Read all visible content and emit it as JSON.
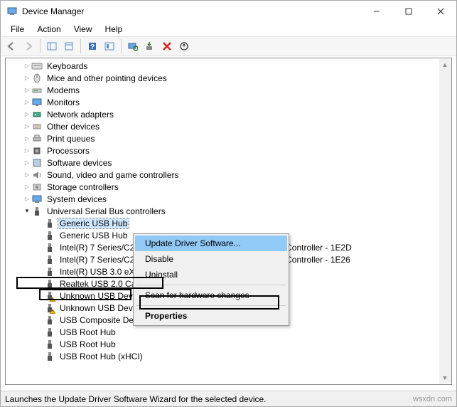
{
  "window": {
    "title": "Device Manager"
  },
  "menu": {
    "file": "File",
    "action": "Action",
    "view": "View",
    "help": "Help"
  },
  "tree": {
    "items": [
      {
        "label": "Keyboards",
        "icon": "keyboard"
      },
      {
        "label": "Mice and other pointing devices",
        "icon": "mouse"
      },
      {
        "label": "Modems",
        "icon": "modem"
      },
      {
        "label": "Monitors",
        "icon": "monitor"
      },
      {
        "label": "Network adapters",
        "icon": "net"
      },
      {
        "label": "Other devices",
        "icon": "other"
      },
      {
        "label": "Print queues",
        "icon": "printer"
      },
      {
        "label": "Processors",
        "icon": "cpu"
      },
      {
        "label": "Software devices",
        "icon": "soft"
      },
      {
        "label": "Sound, video and game controllers",
        "icon": "sound"
      },
      {
        "label": "Storage controllers",
        "icon": "storage"
      },
      {
        "label": "System devices",
        "icon": "system"
      }
    ],
    "usb_category": "Universal Serial Bus controllers",
    "usb_children": [
      {
        "label": "Generic USB Hub",
        "icon": "usb",
        "selected": true
      },
      {
        "label": "Generic USB Hub",
        "icon": "usb"
      },
      {
        "label": "Intel(R) 7 Series/C216 Chipset Family USB Enhanced Host Controller - 1E2D",
        "icon": "usb"
      },
      {
        "label": "Intel(R) 7 Series/C216 Chipset Family USB Enhanced Host Controller - 1E26",
        "icon": "usb"
      },
      {
        "label": "Intel(R) USB 3.0 eXtensible Host Controller",
        "icon": "usb"
      },
      {
        "label": "Realtek USB 2.0 Card Reader",
        "icon": "usb"
      },
      {
        "label": "Unknown USB Device",
        "icon": "usb",
        "warn": true
      },
      {
        "label": "Unknown USB Device",
        "icon": "usb",
        "warn": true
      },
      {
        "label": "USB Composite Device",
        "icon": "usb"
      },
      {
        "label": "USB Root Hub",
        "icon": "usb"
      },
      {
        "label": "USB Root Hub",
        "icon": "usb"
      },
      {
        "label": "USB Root Hub (xHCI)",
        "icon": "usb"
      }
    ]
  },
  "ctx": {
    "update": "Update Driver Software...",
    "disable": "Disable",
    "uninstall": "Uninstall",
    "scan": "Scan for hardware changes",
    "props": "Properties"
  },
  "status": "Launches the Update Driver Software Wizard for the selected device.",
  "watermark": "wsxdn.com"
}
